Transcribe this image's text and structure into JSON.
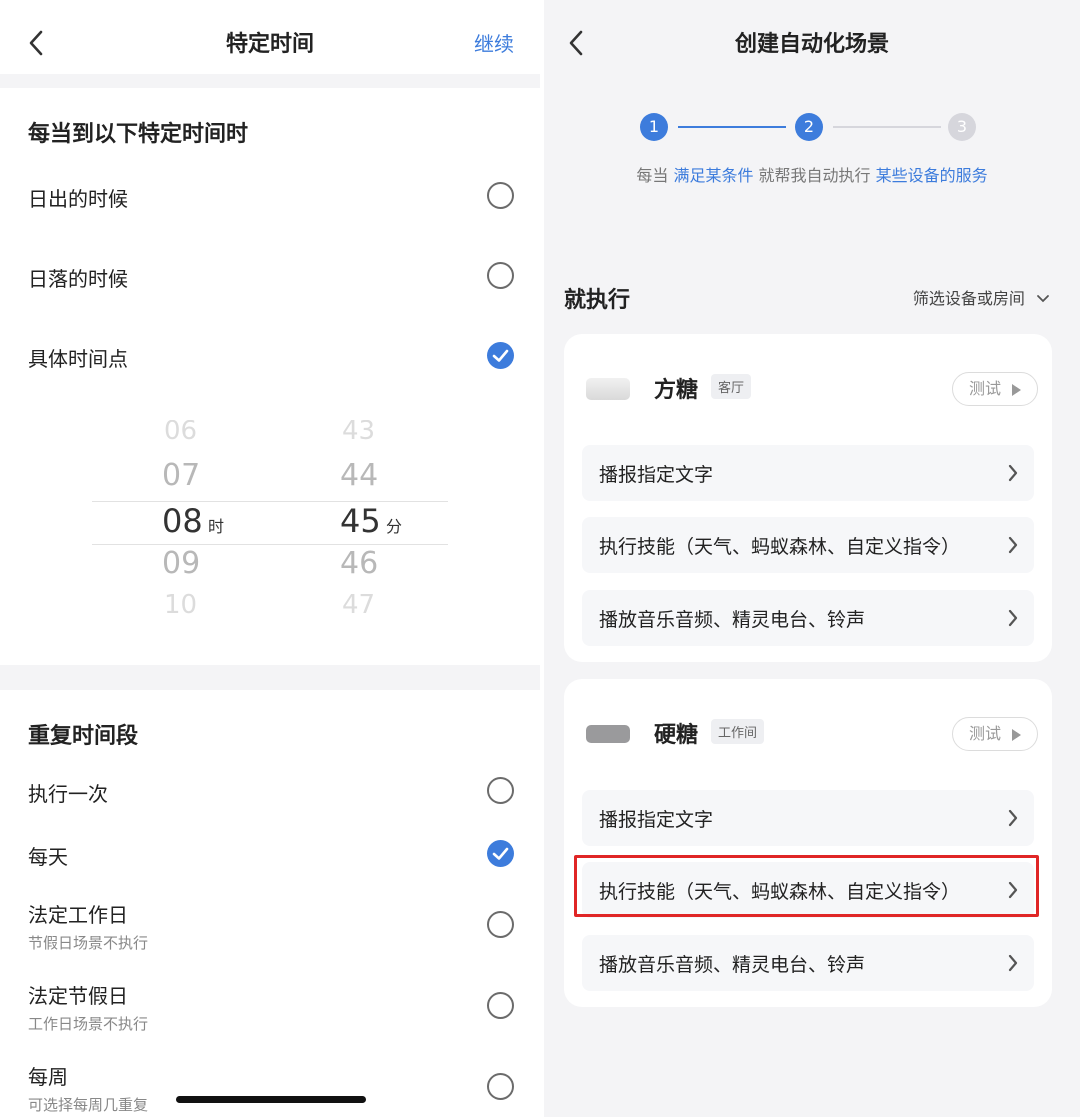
{
  "left": {
    "nav": {
      "title": "特定时间",
      "action": "继续",
      "back_icon": "chevron-left-icon"
    },
    "time_section": {
      "title": "每当到以下特定时间时",
      "options": [
        {
          "label": "日出的时候",
          "checked": false
        },
        {
          "label": "日落的时候",
          "checked": false
        },
        {
          "label": "具体时间点",
          "checked": true
        }
      ]
    },
    "picker": {
      "hours": [
        "06",
        "07",
        "08",
        "09",
        "10"
      ],
      "minutes": [
        "43",
        "44",
        "45",
        "46",
        "47"
      ],
      "selected_hour": "08",
      "selected_minute": "45",
      "hour_unit": "时",
      "minute_unit": "分"
    },
    "repeat_section": {
      "title": "重复时间段",
      "options": [
        {
          "label": "执行一次",
          "sub": "",
          "checked": false
        },
        {
          "label": "每天",
          "sub": "",
          "checked": true
        },
        {
          "label": "法定工作日",
          "sub": "节假日场景不执行",
          "checked": false
        },
        {
          "label": "法定节假日",
          "sub": "工作日场景不执行",
          "checked": false
        },
        {
          "label": "每周",
          "sub": "可选择每周几重复",
          "checked": false
        }
      ]
    }
  },
  "right": {
    "nav": {
      "title": "创建自动化场景",
      "back_icon": "chevron-left-icon"
    },
    "steps": [
      {
        "num": "1",
        "state": "active"
      },
      {
        "num": "2",
        "state": "active"
      },
      {
        "num": "3",
        "state": "inactive"
      }
    ],
    "hint": {
      "p1": "每当 ",
      "h1": "满足某条件",
      "p2": " 就帮我自动执行 ",
      "h2": "某些设备的服务"
    },
    "exec_title": "就执行",
    "filter_label": "筛选设备或房间",
    "devices": [
      {
        "name": "方糖",
        "room": "客厅",
        "test_label": "测试",
        "actions": [
          "播报指定文字",
          "执行技能（天气、蚂蚁森林、自定义指令）",
          "播放音乐音频、精灵电台、铃声"
        ]
      },
      {
        "name": "硬糖",
        "room": "工作间",
        "test_label": "测试",
        "actions": [
          "播报指定文字",
          "执行技能（天气、蚂蚁森林、自定义指令）",
          "播放音乐音频、精灵电台、铃声"
        ]
      }
    ],
    "highlighted_action": "执行技能（天气、蚂蚁森林、自定义指令）"
  },
  "colors": {
    "accent": "#3d7cdc",
    "highlight": "#e02626",
    "page_bg": "#f4f4f6",
    "inactive_step": "#d6d6dc"
  }
}
